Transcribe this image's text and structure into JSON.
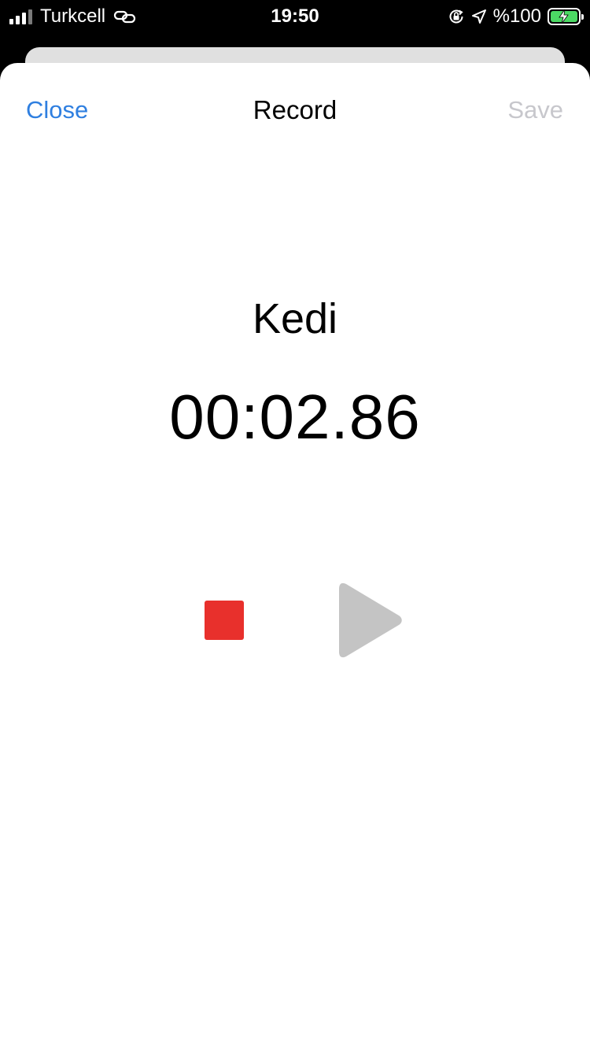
{
  "status_bar": {
    "carrier": "Turkcell",
    "time": "19:50",
    "battery_text": "%100",
    "battery_level": 1.0,
    "battery_color": "#4cd964",
    "icons": [
      "signal-icon",
      "link-icon",
      "orientation-lock-icon",
      "location-icon",
      "battery-icon",
      "charging-bolt-icon"
    ]
  },
  "nav": {
    "close_label": "Close",
    "title": "Record",
    "save_label": "Save"
  },
  "recording": {
    "name": "Kedi",
    "elapsed": "00:02.86"
  },
  "controls": {
    "stop_color": "#e8302c",
    "play_color": "#c4c4c4",
    "stop_icon": "stop-icon",
    "play_icon": "play-icon"
  },
  "colors": {
    "accent": "#2f7fe0",
    "disabled": "#c7c7cc"
  }
}
